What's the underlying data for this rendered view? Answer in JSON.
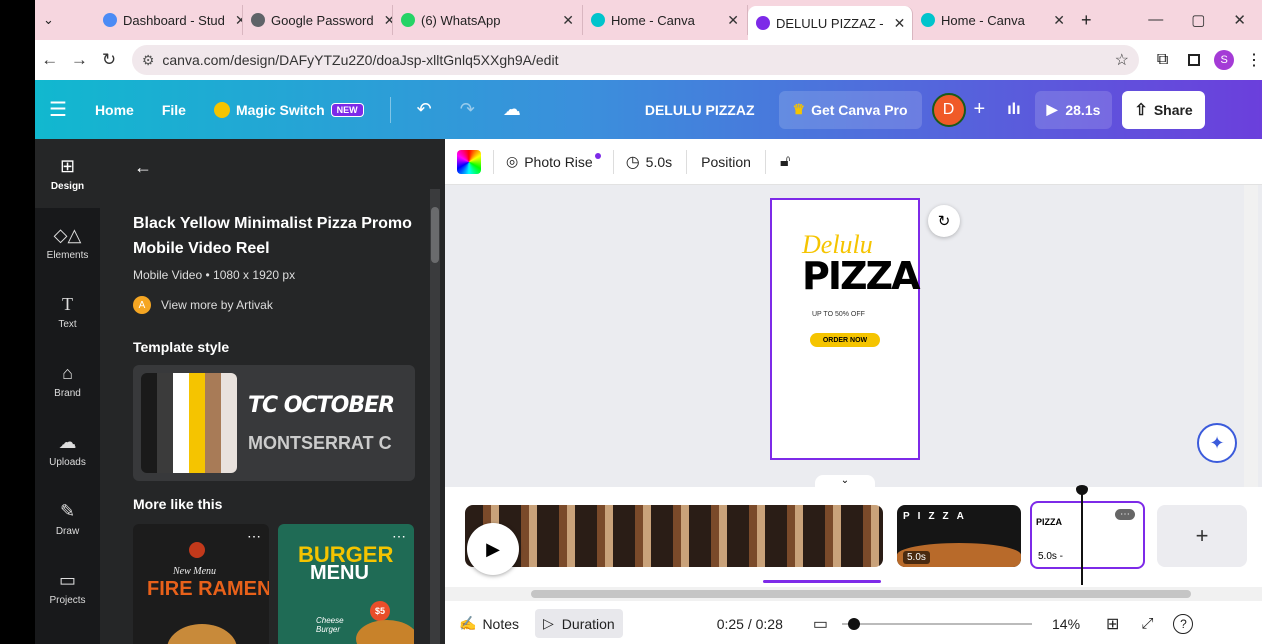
{
  "tabs": [
    {
      "label": "Dashboard - Stud",
      "color": "#4b8bf5"
    },
    {
      "label": "Google Password",
      "color": "#5f6368"
    },
    {
      "label": "(6) WhatsApp",
      "color": "#25d366"
    },
    {
      "label": "Home - Canva",
      "color": "#00c4cc"
    },
    {
      "label": "DELULU PIZZAZ -",
      "color": "#7d2ae8"
    },
    {
      "label": "Home - Canva",
      "color": "#00c4cc"
    }
  ],
  "url": "canva.com/design/DAFyYTZu2Z0/doaJsp-xlltGnlq5XXgh9A/edit",
  "profile_initial": "S",
  "header": {
    "home": "Home",
    "file": "File",
    "magic": "Magic Switch",
    "new_badge": "NEW",
    "design_title": "DELULU PIZZAZ",
    "pro": "Get Canva Pro",
    "avatar": "D",
    "play_time": "28.1s",
    "share": "Share"
  },
  "rail": [
    "Design",
    "Elements",
    "Text",
    "Brand",
    "Uploads",
    "Draw",
    "Projects"
  ],
  "panel": {
    "title": "Black Yellow Minimalist Pizza Promo Mobile Video Reel",
    "meta": "Mobile Video • 1080 x 1920 px",
    "author_initial": "A",
    "author": "View more by Artivak",
    "style_heading": "Template style",
    "font1": "TC OCTOBER",
    "font2": "MONTSERRAT C",
    "palette": [
      "#1a1a1a",
      "#3b3b3b",
      "#ffffff",
      "#f5c400",
      "#a87b57",
      "#e9e2dd"
    ],
    "more_heading": "More like this",
    "thumb1": {
      "t1": "New Menu",
      "t2": "FIRE RAMEN"
    },
    "thumb2": {
      "t1": "BURGER",
      "t2": "MENU",
      "t3": "Cheese Burger",
      "price": "$5"
    }
  },
  "toolbar": {
    "effect": "Photo Rise",
    "duration": "5.0s",
    "position": "Position"
  },
  "canvas": {
    "script": "Delulu",
    "pizza": "PIZZA",
    "offer": "UP TO 50% OFF",
    "cta": "ORDER NOW"
  },
  "timeline": {
    "clip2_dur": "5.0s",
    "clip3_dur": "5.0s -",
    "notes": "Notes",
    "duration": "Duration",
    "time": "0:25 / 0:28",
    "zoom": "14%",
    "help": "?",
    "clip_mini": "PIZZA"
  }
}
